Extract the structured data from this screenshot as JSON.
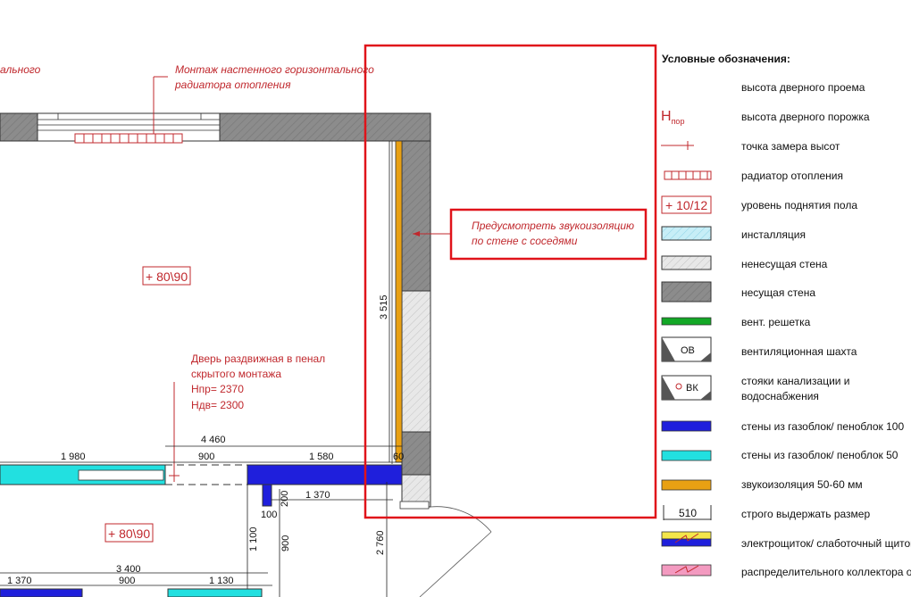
{
  "notes": {
    "top_left_cut": "ального",
    "radiator_note_line1": "Монтаж настенного горизонтального",
    "radiator_note_line2": "радиатора отопления",
    "sound_note_line1": "Предусмотреть звукоизоляцию",
    "sound_note_line2": "по стене с соседями",
    "door_note_line1": "Дверь раздвижная в пенал",
    "door_note_line2": "скрытого монтажа",
    "door_note_hpr": "Hпр= 2370",
    "door_note_hdv": "Hдв= 2300"
  },
  "floor_marks": {
    "upper": "+ 80\\90",
    "lower": "+ 80\\90"
  },
  "dimensions": {
    "d1980": "1 980",
    "d4460": "4 460",
    "d900a": "900",
    "d1580": "1 580",
    "d60": "60",
    "d1370a": "1 370",
    "d200": "200",
    "d100": "100",
    "d1100": "1 100",
    "d900b": "900",
    "d2760": "2 760",
    "d3515": "3 515",
    "d3400": "3 400",
    "d1370b": "1 370",
    "d900c": "900",
    "d1130": "1 130"
  },
  "legend": {
    "title": "Условные обозначения:",
    "items": [
      {
        "label": "высота дверного проема"
      },
      {
        "label": "высота дверного порожка",
        "symbol": "Hпор"
      },
      {
        "label": "точка замера высот"
      },
      {
        "label": "радиатор отопления"
      },
      {
        "label": "уровень поднятия пола",
        "symbol": "+ 10/12"
      },
      {
        "label": "инсталляция"
      },
      {
        "label": "ненесущая стена"
      },
      {
        "label": "несущая стена"
      },
      {
        "label": "вент. решетка"
      },
      {
        "label": "вентиляционная шахта",
        "symbol": "ОВ"
      },
      {
        "label": "стояки канализации и",
        "label2": "водоснабжения",
        "symbol": "ВК"
      },
      {
        "label": "стены из газоблок/ пеноблок 100"
      },
      {
        "label": "стены из газоблок/ пеноблок 50"
      },
      {
        "label": "звукоизоляция 50-60  мм"
      },
      {
        "label": "строго выдержать размер",
        "symbol": "510"
      },
      {
        "label": "электрощиток/ слаботочный щиток"
      },
      {
        "label": "распределительного коллектора отопления"
      }
    ]
  },
  "colors": {
    "red": "#c0282d",
    "highlight": "#e0131a",
    "bearing_wall": "#8c8c8c",
    "light_wall": "#e4e4e4",
    "blue_block": "#1f1fdc",
    "cyan_block": "#22e0e0",
    "insulation": "#e8a013",
    "vent_green": "#13a826",
    "install_blue": "#c7eef7",
    "pink": "#f39ac0",
    "yellow": "#f4e64a"
  }
}
